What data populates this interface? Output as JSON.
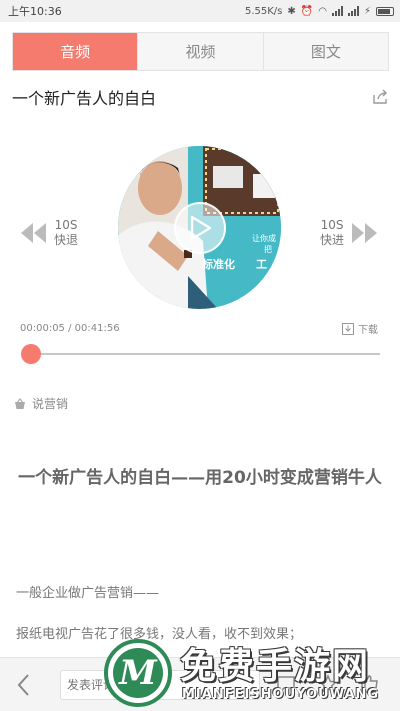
{
  "status_bar": {
    "time": "上午10:36",
    "speed": "5.55K/s"
  },
  "tabs": [
    {
      "label": "音频",
      "active": true
    },
    {
      "label": "视频",
      "active": false
    },
    {
      "label": "图文",
      "active": false
    }
  ],
  "header": {
    "title": "一个新广告人的自白"
  },
  "player": {
    "rewind": {
      "amount": "10S",
      "label": "快退"
    },
    "forward": {
      "amount": "10S",
      "label": "快进"
    },
    "time_display": "00:00:05 / 00:41:56",
    "download_label": "下载",
    "progress": 0.002,
    "cover": {
      "text1": "标准化",
      "text2": "工",
      "text3": "让你成",
      "text4": "把"
    }
  },
  "category": {
    "label": "说营销"
  },
  "article": {
    "title": "一个新广告人的自白——用20小时变成营销牛人",
    "paragraphs": [
      "一般企业做广告营销——",
      "报纸电视广告花了很多钱，没人看，收不到效果；"
    ]
  },
  "bottom_bar": {
    "comment_placeholder": "发表评论"
  },
  "watermark": {
    "title": "免费手游网",
    "subtitle": "MIANFEISHOUYOUWANG",
    "logo_letter": "M"
  },
  "colors": {
    "accent": "#f47b6e",
    "watermark_green": "#2e8a56"
  }
}
